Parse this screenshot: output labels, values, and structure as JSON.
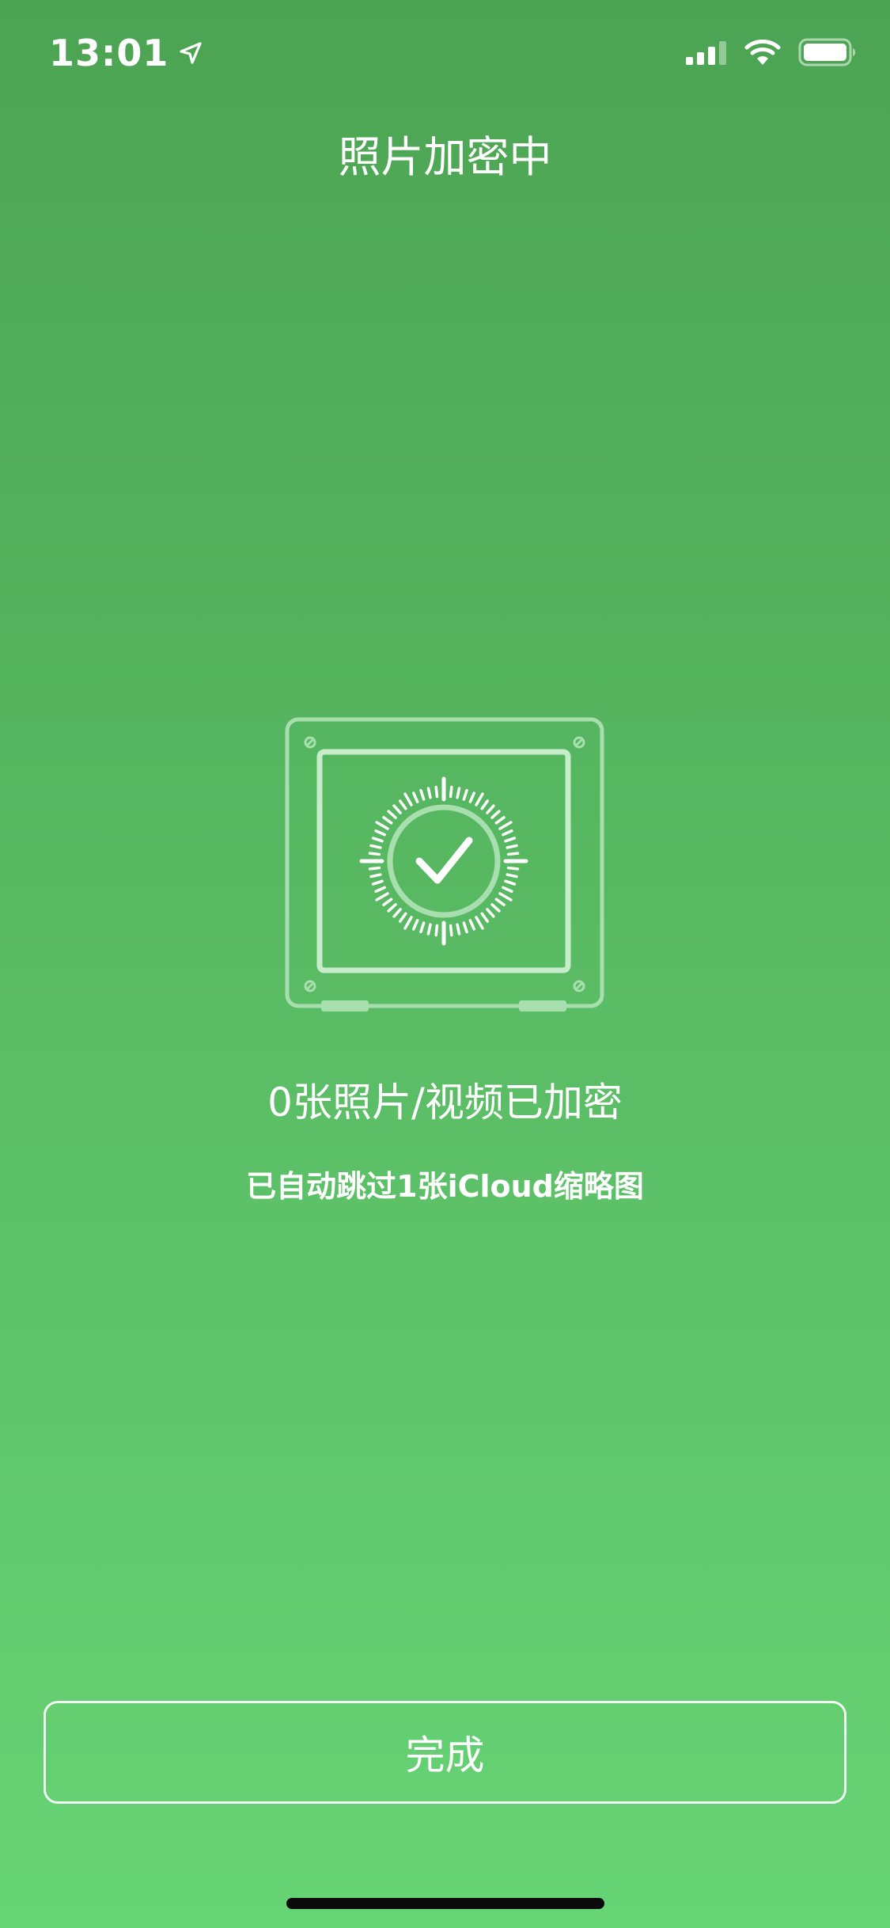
{
  "status_bar": {
    "time": "13:01",
    "location_icon": "location-arrow-icon",
    "signal_icon": "cellular-signal-icon",
    "wifi_icon": "wifi-icon",
    "battery_icon": "battery-icon"
  },
  "header": {
    "title": "照片加密中"
  },
  "content": {
    "safe_icon": "safe-check-icon",
    "encrypted_summary": "0张照片/视频已加密",
    "skipped_note": "已自动跳过1张iCloud缩略图"
  },
  "footer": {
    "done_label": "完成"
  },
  "colors": {
    "background_top": "#4ca453",
    "background_bottom": "#67d475",
    "foreground": "#ffffff",
    "safe_outline": "#a7dfae",
    "home_indicator": "#0a0a0a"
  }
}
